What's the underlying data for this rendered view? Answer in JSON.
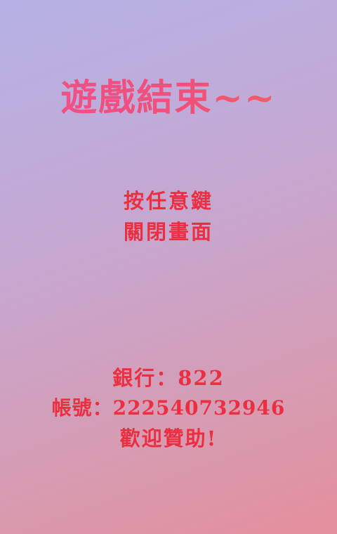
{
  "game_over": {
    "title": "遊戲結束~~",
    "prompt_line1": "按任意鍵",
    "prompt_line2": "關閉畫面"
  },
  "donation": {
    "bank_line": "銀行：822",
    "account_line": "帳號：222540732946",
    "thanks_line": "歡迎贊助!"
  },
  "colors": {
    "text_red": "#ec2f40",
    "title_pink": "#f0508a",
    "bg_top": "#b6b2e6",
    "bg_bottom": "#e58e9c"
  }
}
